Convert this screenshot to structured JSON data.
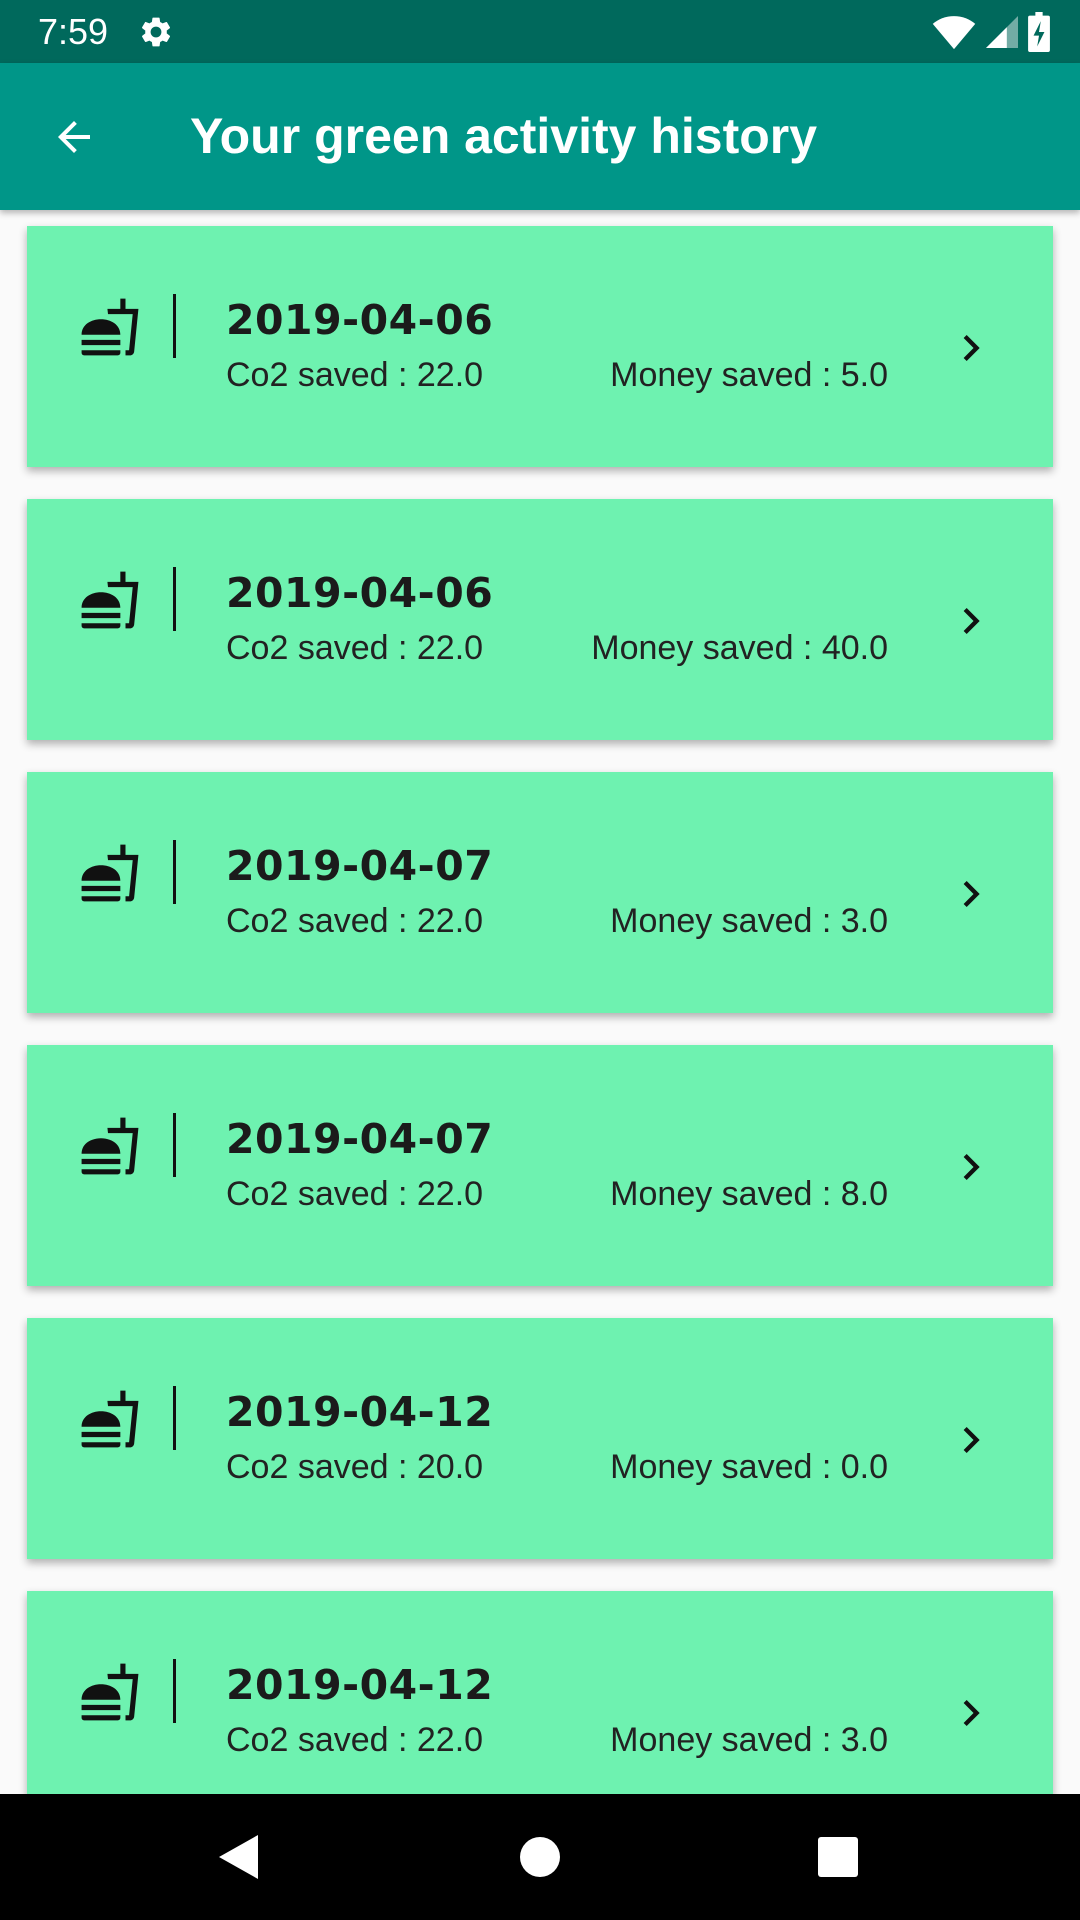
{
  "status_bar": {
    "time": "7:59"
  },
  "app_bar": {
    "title": "Your green activity history"
  },
  "activities": [
    {
      "date": "2019-04-06",
      "co2": "Co2 saved : 22.0",
      "money": "Money saved : 5.0"
    },
    {
      "date": "2019-04-06",
      "co2": "Co2 saved : 22.0",
      "money": "Money saved : 40.0"
    },
    {
      "date": "2019-04-07",
      "co2": "Co2 saved : 22.0",
      "money": "Money saved : 3.0"
    },
    {
      "date": "2019-04-07",
      "co2": "Co2 saved : 22.0",
      "money": "Money saved : 8.0"
    },
    {
      "date": "2019-04-12",
      "co2": "Co2 saved : 20.0",
      "money": "Money saved : 0.0"
    },
    {
      "date": "2019-04-12",
      "co2": "Co2 saved : 22.0",
      "money": "Money saved : 3.0"
    }
  ],
  "icons": {
    "status": [
      "settings-gear-icon",
      "wifi-icon",
      "cell-signal-icon",
      "battery-charging-icon"
    ],
    "app_bar": "back-arrow-icon",
    "card": [
      "food-drink-icon",
      "chevron-right-icon"
    ],
    "nav": [
      "nav-back-icon",
      "nav-home-icon",
      "nav-recents-icon"
    ]
  },
  "colors": {
    "status_bar": "#00695c",
    "app_bar": "#009688",
    "card": "#6ef2b0",
    "nav_bar": "#000000"
  }
}
